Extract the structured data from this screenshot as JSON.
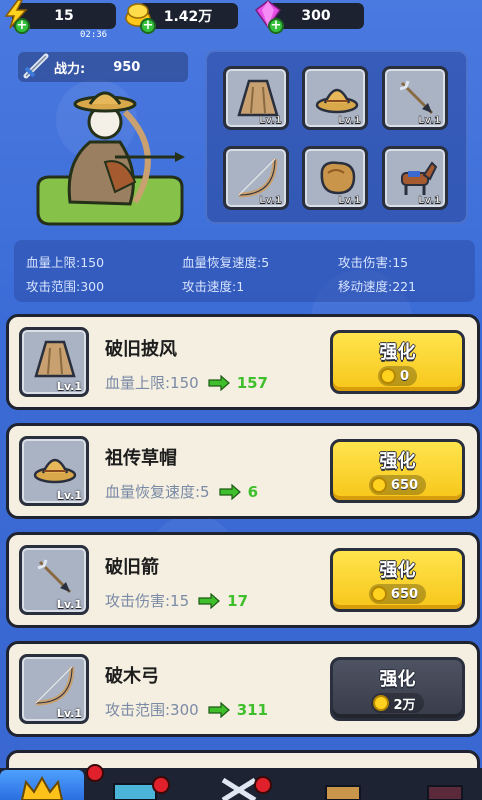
{
  "resources": {
    "energy": "15",
    "gold": "1.42万",
    "gems": "300",
    "timer": "02:36"
  },
  "character": {
    "power_label": "战力:",
    "power_value": "950"
  },
  "equipment_slots": [
    {
      "name": "cloak",
      "level": "Lv.1"
    },
    {
      "name": "straw-hat",
      "level": "Lv.1"
    },
    {
      "name": "arrow",
      "level": "Lv.1"
    },
    {
      "name": "bow",
      "level": "Lv.1"
    },
    {
      "name": "bread",
      "level": "Lv.1"
    },
    {
      "name": "horse",
      "level": "Lv.1"
    }
  ],
  "stats": [
    "血量上限:150",
    "血量恢复速度:5",
    "攻击伤害:15",
    "攻击范围:300",
    "攻击速度:1",
    "移动速度:221"
  ],
  "items": [
    {
      "name": "破旧披风",
      "level": "Lv.1",
      "stat": "血量上限:150",
      "next": "157",
      "upgrade_label": "强化",
      "cost": "0",
      "affordable": true
    },
    {
      "name": "祖传草帽",
      "level": "Lv.1",
      "stat": "血量恢复速度:5",
      "next": "6",
      "upgrade_label": "强化",
      "cost": "650",
      "affordable": true
    },
    {
      "name": "破旧箭",
      "level": "Lv.1",
      "stat": "攻击伤害:15",
      "next": "17",
      "upgrade_label": "强化",
      "cost": "650",
      "affordable": true
    },
    {
      "name": "破木弓",
      "level": "Lv.1",
      "stat": "攻击范围:300",
      "next": "311",
      "upgrade_label": "强化",
      "cost": "2万",
      "affordable": false
    }
  ],
  "colors": {
    "background": "#3f6fd8",
    "button_yellow": "#f7c619",
    "button_gray": "#383c49",
    "green_value": "#3fbf2b"
  }
}
